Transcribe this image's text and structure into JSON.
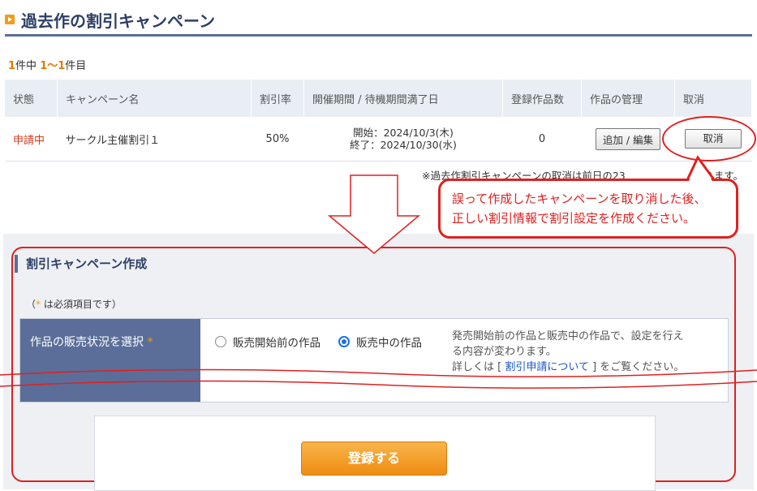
{
  "page": {
    "title": "過去作の割引キャンペーン"
  },
  "results": {
    "total": "1",
    "of_label": "件中",
    "range": "1～1",
    "unit": "件目"
  },
  "table": {
    "headers": [
      "状態",
      "キャンペーン名",
      "割引率",
      "開催期間 / 待機期間満了日",
      "登録作品数",
      "作品の管理",
      "取消"
    ],
    "rows": [
      {
        "status": "申請中",
        "name": "サークル主催割引１",
        "rate": "50%",
        "start": "開始：2024/10/3(木)",
        "end": "終了：2024/10/30(水)",
        "count": "0",
        "manage_button": "追加 / 編集",
        "cancel_button": "取消"
      }
    ]
  },
  "note": "※過去作割引キャンペーンの取消は前日の23",
  "note_tail": "なります。",
  "callout": {
    "line1": "誤って作成したキャンペーンを取り消した後、",
    "line2": "正しい割引情報で割引設定を作成ください。"
  },
  "form": {
    "heading": "割引キャンペーン作成",
    "required_note_pre": "（",
    "required_star": "*",
    "required_note_post": "は必須項目です）",
    "row_label": "作品の販売状況を選択",
    "row_star": "*",
    "options": [
      {
        "label": "販売開始前の作品",
        "checked": false
      },
      {
        "label": "販売中の作品",
        "checked": true
      }
    ],
    "help_line1": "発売開始前の作品と販売中の作品で、設定を行え",
    "help_line2": "る内容が変わります。",
    "help_pre": "詳しくは [ ",
    "help_link": "割引申請について",
    "help_post": " ] をご覧ください。",
    "submit": "登録する"
  },
  "colors": {
    "accent": "#f29b1a",
    "annotation": "#e02020",
    "header_bar": "#5a6e99",
    "status": "#d23a1a"
  }
}
